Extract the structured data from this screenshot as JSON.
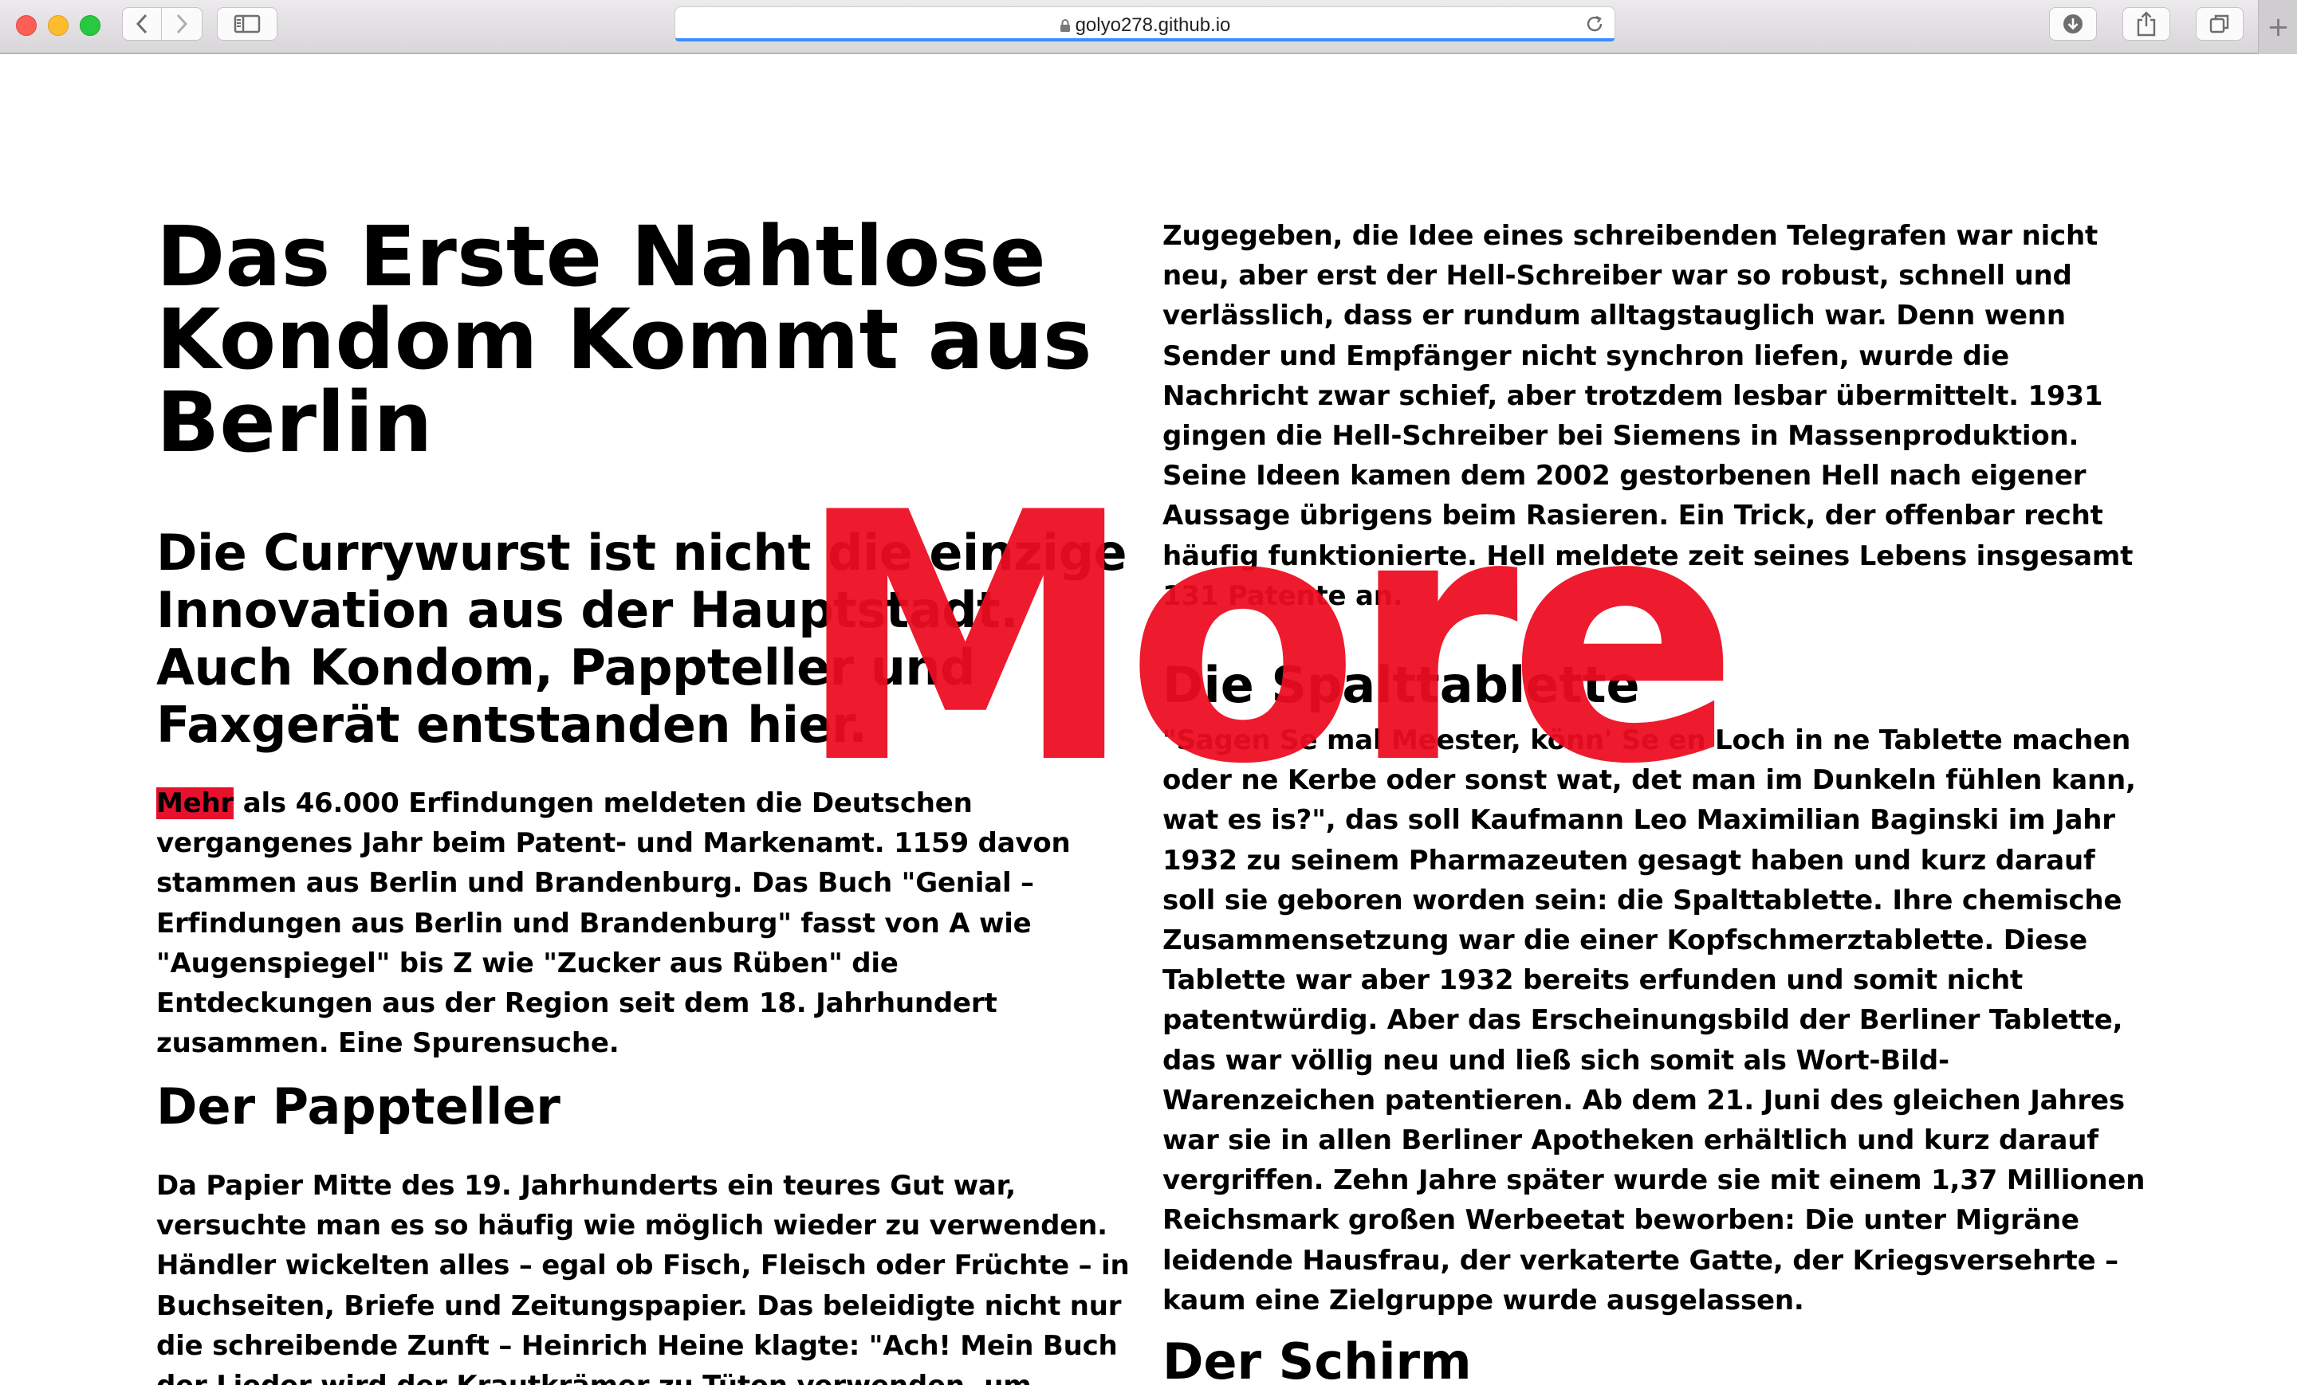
{
  "browser": {
    "url": "golyo278.github.io"
  },
  "article": {
    "title": "Das Erste Nahtlose Kondom Kommt aus Berlin",
    "lede": "Die Currywurst ist nicht die einzige Innovation aus der Hauptstadt. Auch Kondom, Pappteller und Faxgerät entstanden hier.",
    "intro_highlight": "Mehr",
    "intro_rest": " als 46.000 Erfindungen meldeten die Deutschen vergangenes Jahr beim Patent- und Markenamt. 1159 davon stammen aus Berlin und Brandenburg. Das Buch \"Genial – Erfindungen aus Berlin und Brandenburg\" fasst von A wie \"Augenspiegel\" bis Z wie \"Zucker aus Rüben\" die Entdeckungen aus der Region seit dem 18. Jahrhundert zusammen. Eine Spurensuche.",
    "section_pappteller_heading": "Der Pappteller",
    "section_pappteller_text": "Da Papier Mitte des 19. Jahrhunderts ein teures Gut war, versuchte man es so häufig wie möglich wieder zu verwenden. Händler wickelten alles – egal ob Fisch, Fleisch oder Früchte – in Buchseiten, Briefe und Zeitungspapier. Das beleidigte nicht nur die schreibende Zunft – Heinrich Heine klagte: \"Ach! Mein Buch der Lieder wird der Krautkrämer zu Tüten verwenden, um Kaffee oder Schnupftabak darin",
    "hell_text": "Zugegeben, die Idee eines schreibenden Telegrafen war nicht neu, aber erst der Hell-Schreiber war so robust, schnell und verlässlich, dass er rundum alltagstauglich war. Denn wenn Sender und Empfänger nicht synchron liefen, wurde die Nachricht zwar schief, aber trotzdem lesbar übermittelt. 1931 gingen die Hell-Schreiber bei Siemens in Massenproduktion. Seine Ideen kamen dem 2002 gestorbenen Hell nach eigener Aussage übrigens beim Rasieren. Ein Trick, der offenbar recht häufig funktionierte. Hell meldete zeit seines Lebens insgesamt 131 Patente an.",
    "section_spalt_heading": "Die Spalttablette",
    "section_spalt_text": "\"Sagen Se mal Meester, könn' Se en Loch in ne Tablette machen oder ne Kerbe oder sonst wat, det man im Dunkeln fühlen kann, wat es is?\", das soll Kaufmann Leo Maximilian Baginski im Jahr 1932 zu seinem Pharmazeuten gesagt haben und kurz darauf soll sie geboren worden sein: die Spalttablette. Ihre chemische Zusammensetzung war die einer Kopfschmerztablette. Diese Tablette war aber 1932 bereits erfunden und somit nicht patentwürdig. Aber das Erscheinungsbild der Berliner Tablette, das war völlig neu und ließ sich somit als Wort-Bild-Warenzeichen patentieren. Ab dem 21. Juni des gleichen Jahres war sie in allen Berliner Apotheken erhältlich und kurz darauf vergriffen. Zehn Jahre später wurde sie mit einem 1,37 Millionen Reichsmark großen Werbeetat beworben: Die unter Migräne leidende Hausfrau, der verkaterte Gatte, der Kriegsversehrte – kaum eine Zielgruppe wurde ausgelassen.",
    "section_schirm_heading": "Der Schirm"
  },
  "overlay": {
    "label": "More",
    "color": "#ec0d20"
  }
}
